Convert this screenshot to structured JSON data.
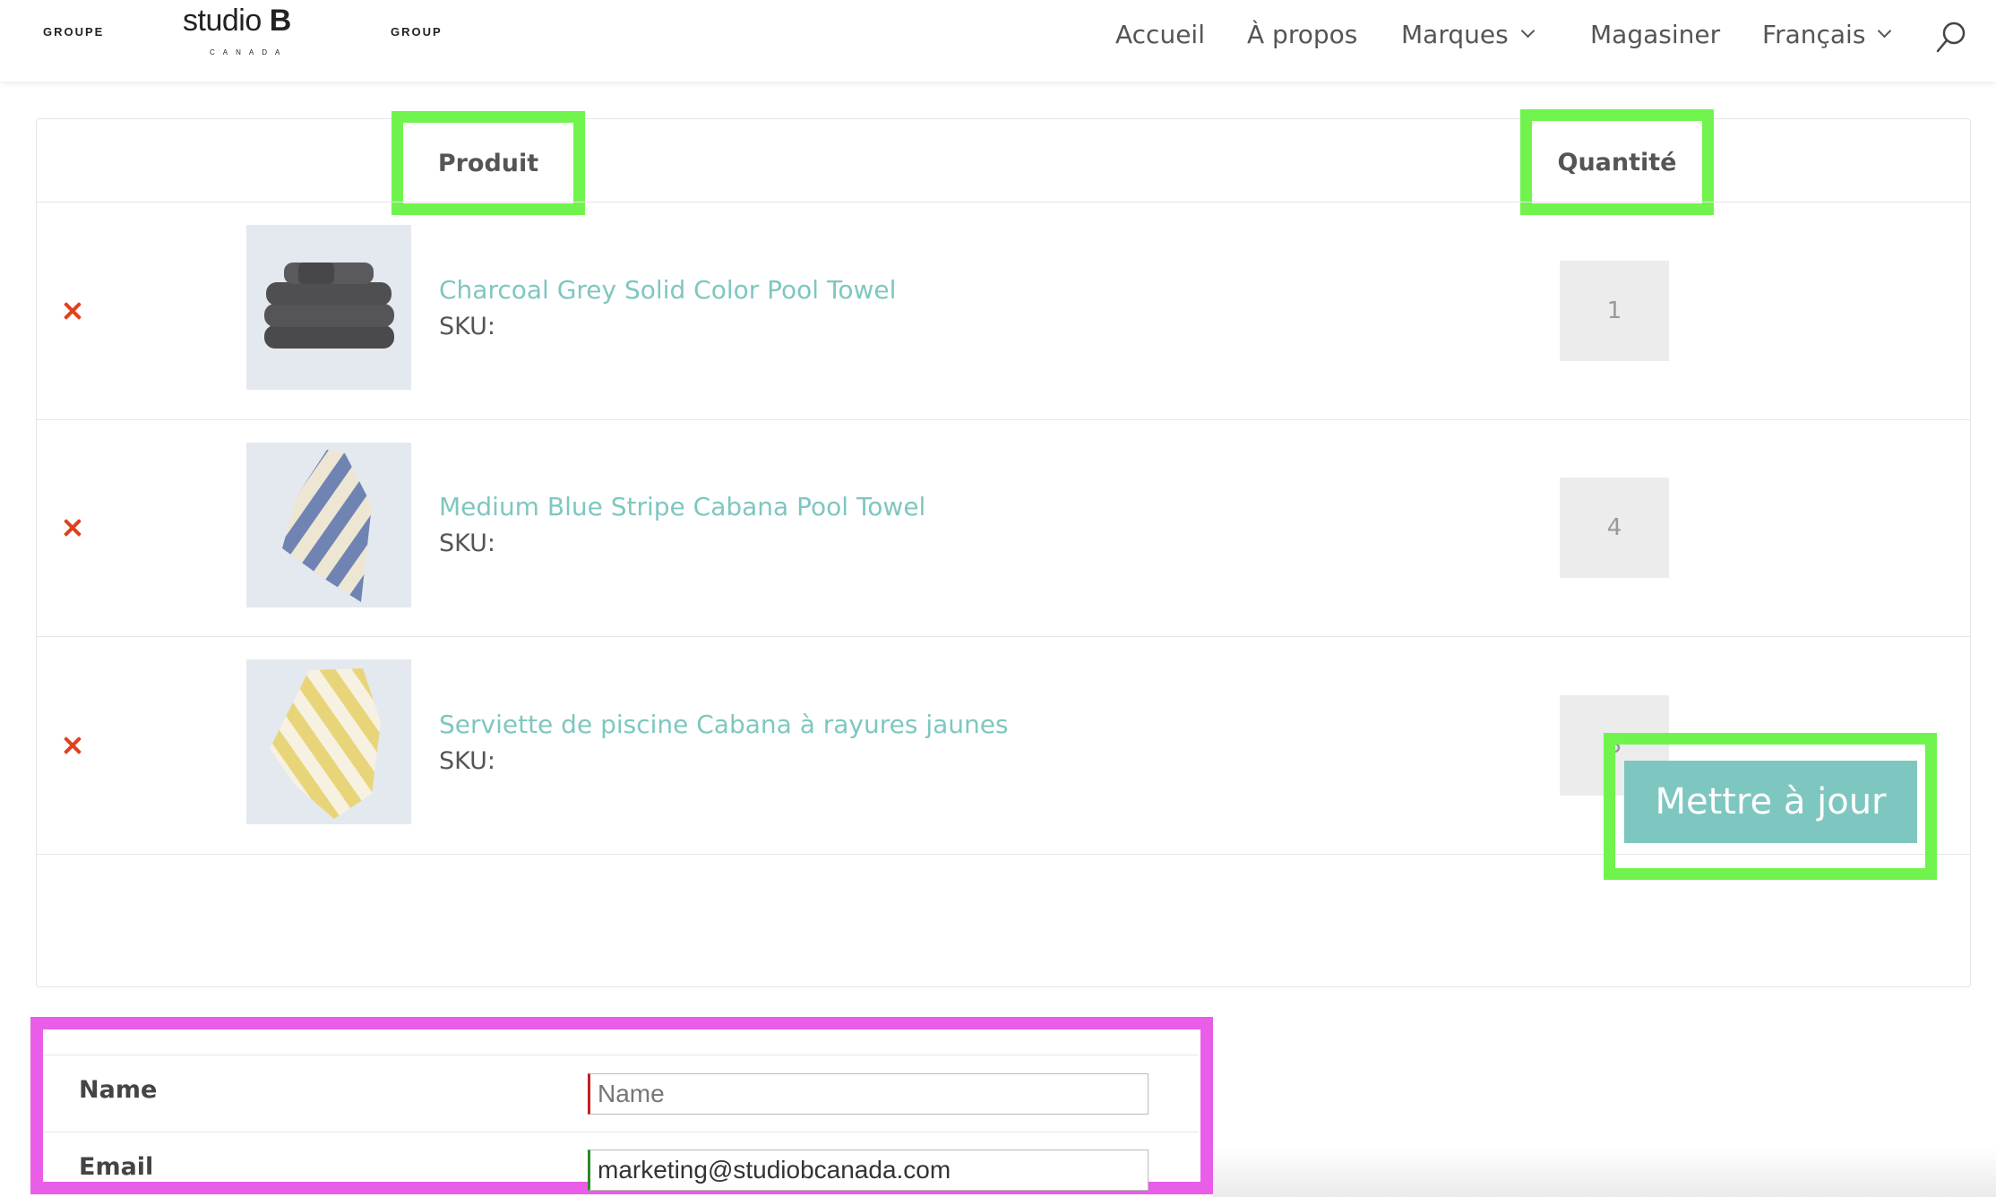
{
  "header": {
    "logo": {
      "left_word": "GROUPE",
      "brand": "studio",
      "brand_bold": "B",
      "sub": "CANADA",
      "right_word": "GROUP"
    },
    "nav": [
      {
        "label": "Accueil",
        "has_dropdown": false
      },
      {
        "label": "À propos",
        "has_dropdown": false
      },
      {
        "label": "Marques",
        "has_dropdown": true
      },
      {
        "label": "Magasiner",
        "has_dropdown": false
      },
      {
        "label": "Français",
        "has_dropdown": true
      }
    ],
    "search_icon": "search-icon"
  },
  "cart": {
    "columns": {
      "product": "Produit",
      "quantity": "Quantité"
    },
    "items": [
      {
        "name": "Charcoal Grey Solid Color Pool Towel",
        "sku_label": "SKU:",
        "quantity": "1",
        "thumb": "charcoal-towels"
      },
      {
        "name": "Medium Blue Stripe Cabana Pool Towel",
        "sku_label": "SKU:",
        "quantity": "4",
        "thumb": "blue-stripe-towel"
      },
      {
        "name": "Serviette de piscine Cabana à rayures jaunes",
        "sku_label": "SKU:",
        "quantity": "3",
        "thumb": "yellow-stripe-towel"
      }
    ],
    "update_button": "Mettre à jour"
  },
  "form": {
    "name_label": "Name",
    "name_placeholder": "Name",
    "email_label": "Email",
    "email_value": "marketing@studiobcanada.com"
  },
  "colors": {
    "accent": "#7ec7c0",
    "remove": "#e2401c",
    "highlight_green": "#70f44d",
    "highlight_magenta": "#e95de9"
  }
}
